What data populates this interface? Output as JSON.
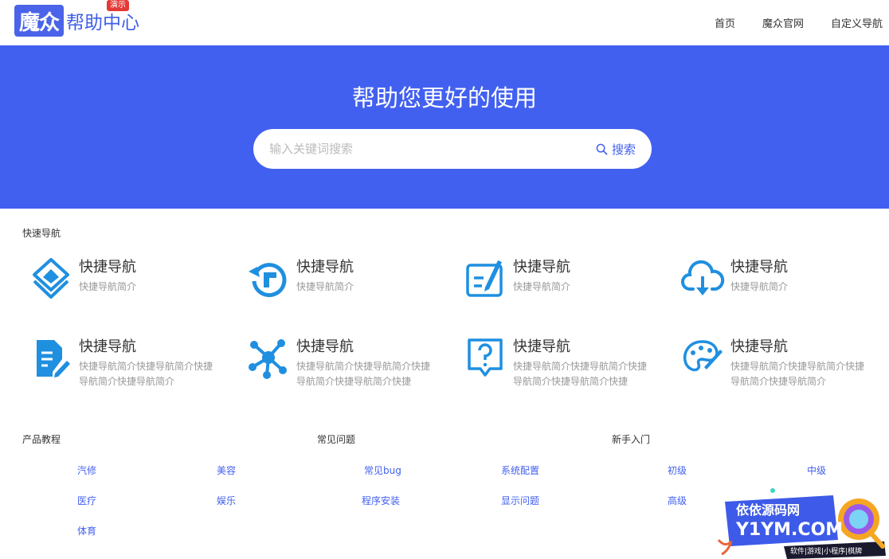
{
  "header": {
    "logo_mark": "魔众",
    "logo_text": "帮助中心",
    "logo_badge": "演示",
    "nav": [
      "首页",
      "魔众官网",
      "自定义导航"
    ]
  },
  "hero": {
    "title": "帮助您更好的使用",
    "search_placeholder": "输入关键词搜索",
    "search_button": "搜索"
  },
  "quick_nav": {
    "title": "快速导航",
    "items": [
      {
        "title": "快捷导航",
        "desc": "快捷导航简介",
        "icon": "layers-icon"
      },
      {
        "title": "快捷导航",
        "desc": "快捷导航简介",
        "icon": "refresh-icon"
      },
      {
        "title": "快捷导航",
        "desc": "快捷导航简介",
        "icon": "edit-board-icon"
      },
      {
        "title": "快捷导航",
        "desc": "快捷导航简介",
        "icon": "cloud-download-icon"
      },
      {
        "title": "快捷导航",
        "desc": "快捷导航简介快捷导航简介快捷导航简介快捷导航简介",
        "icon": "document-edit-icon"
      },
      {
        "title": "快捷导航",
        "desc": "快捷导航简介快捷导航简介快捷导航简介快捷导航简介快捷",
        "icon": "network-icon"
      },
      {
        "title": "快捷导航",
        "desc": "快捷导航简介快捷导航简介快捷导航简介快捷导航简介快捷",
        "icon": "question-bubble-icon"
      },
      {
        "title": "快捷导航",
        "desc": "快捷导航简介快捷导航简介快捷导航简介快捷导航简介",
        "icon": "palette-icon"
      }
    ]
  },
  "categories": [
    {
      "title": "产品教程",
      "links": [
        "汽修",
        "美容",
        "医疗",
        "娱乐",
        "体育"
      ]
    },
    {
      "title": "常见问题",
      "links": [
        "常见bug",
        "系统配置",
        "程序安装",
        "显示问题"
      ]
    },
    {
      "title": "新手入门",
      "links": [
        "初级",
        "中级",
        "高级"
      ]
    }
  ],
  "watermark": {
    "line1": "依依源码网",
    "line2": "Y1YM.COM",
    "line3": "软件|游戏|小程序|棋牌"
  },
  "colors": {
    "accent": "#4260F0",
    "icon": "#1F8FE0",
    "badge": "#E53935"
  }
}
